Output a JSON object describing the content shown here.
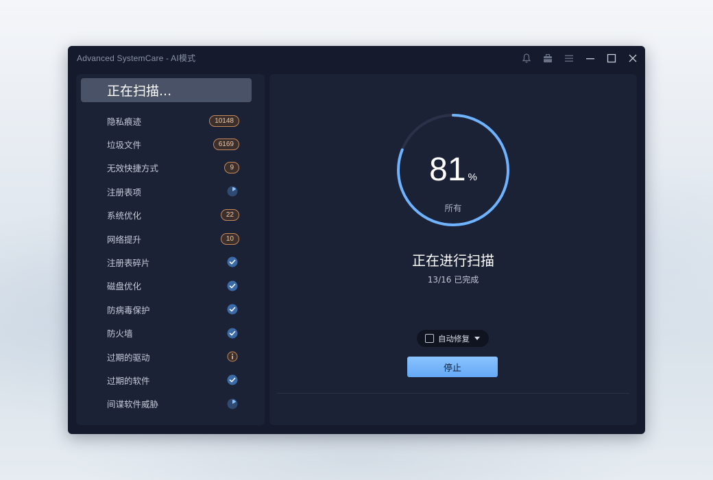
{
  "window": {
    "title": "Advanced SystemCare - AI模式",
    "accent": "#6fb3ff"
  },
  "sidebar": {
    "active_label": "正在扫描...",
    "items": [
      {
        "label": "隐私痕迹",
        "badge": "10148",
        "status": "count"
      },
      {
        "label": "垃圾文件",
        "badge": "6169",
        "status": "count"
      },
      {
        "label": "无效快捷方式",
        "badge": "9",
        "status": "count"
      },
      {
        "label": "注册表项",
        "badge": "",
        "status": "scanning",
        "icon": "progress-pie-icon"
      },
      {
        "label": "系统优化",
        "badge": "22",
        "status": "count"
      },
      {
        "label": "网络提升",
        "badge": "10",
        "status": "count"
      },
      {
        "label": "注册表碎片",
        "badge": "",
        "status": "ok",
        "icon": "check-circle-icon"
      },
      {
        "label": "磁盘优化",
        "badge": "",
        "status": "ok",
        "icon": "check-circle-icon"
      },
      {
        "label": "防病毒保护",
        "badge": "",
        "status": "ok",
        "icon": "check-circle-icon"
      },
      {
        "label": "防火墙",
        "badge": "",
        "status": "ok",
        "icon": "check-circle-icon"
      },
      {
        "label": "过期的驱动",
        "badge": "",
        "status": "warning",
        "icon": "info-circle-icon"
      },
      {
        "label": "过期的软件",
        "badge": "",
        "status": "ok",
        "icon": "check-circle-icon"
      },
      {
        "label": "间谍软件威胁",
        "badge": "",
        "status": "scanning",
        "icon": "progress-pie-icon"
      }
    ]
  },
  "main": {
    "progress_percent": 81,
    "percent_value": "81",
    "percent_sign": "%",
    "ring_sublabel": "所有",
    "scan_title": "正在进行扫描",
    "scan_subtitle": "13/16 已完成",
    "auto_fix_label": "自动修复",
    "auto_fix_checked": false,
    "stop_label": "停止"
  }
}
